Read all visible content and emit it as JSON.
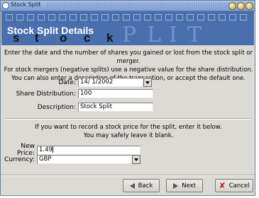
{
  "window": {
    "title": "Stock Split"
  },
  "banner": {
    "title": "Stock Split Details",
    "letters": [
      "s",
      "t",
      "o",
      "c",
      "k"
    ],
    "watermark": [
      "P",
      "L",
      "I",
      "T"
    ]
  },
  "intro": {
    "line1": "Enter the date and the number of shares you gained or lost from the stock split or merger.",
    "line2": "For stock mergers (negative splits) use a negative value for the share distribution.",
    "line3": "You can also enter a description of the transaction, or accept the default one."
  },
  "form": {
    "date_label": "Date:",
    "date_value": "14/ 1/2002",
    "distribution_label": "Share Distribution:",
    "distribution_value": "100",
    "description_label": "Description:",
    "description_value": "Stock Split"
  },
  "price": {
    "note_line1": "If you want to record a stock price for the split, enter it below.",
    "note_line2": "You may safely leave it blank.",
    "new_price_label": "New Price:",
    "new_price_value": "1.49",
    "currency_label": "Currency:",
    "currency_value": "GBP"
  },
  "buttons": {
    "back": "Back",
    "next": "Next",
    "cancel": "Cancel"
  },
  "icons": {
    "back": "left-arrow-icon",
    "next": "right-arrow-icon",
    "cancel": "close-x-icon",
    "title": "app-icon"
  }
}
